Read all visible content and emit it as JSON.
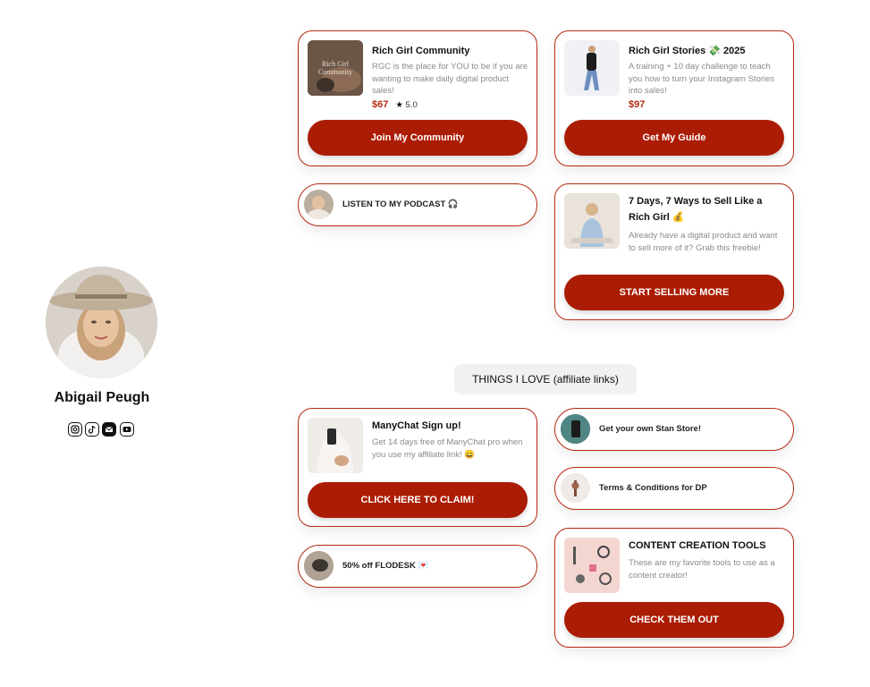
{
  "profile": {
    "name": "Abigail Peugh",
    "social_icons": [
      "instagram-icon",
      "tiktok-icon",
      "email-icon",
      "youtube-icon"
    ]
  },
  "cards": {
    "rgc": {
      "title": "Rich Girl Community",
      "thumb_text": "Rich Girl Community",
      "description": "RGC is the place for YOU to be if you are wanting to make daily digital product sales!",
      "price": "$67",
      "rating": "5.0",
      "button": "Join My Community"
    },
    "stories": {
      "title": "Rich Girl Stories 💸 2025",
      "description": "A training + 10 day challenge to teach you how to turn your Instagram Stories into sales!",
      "price": "$97",
      "button": "Get My Guide"
    },
    "podcast": {
      "label": "LISTEN TO MY PODCAST 🎧"
    },
    "seven_days": {
      "title": "7 Days, 7 Ways to Sell Like a Rich Girl 💰",
      "description": "Already have a digital product and want to sell more of it? Grab this freebie!",
      "button": "START SELLING MORE"
    },
    "manychat": {
      "title": "ManyChat Sign up!",
      "description": "Get 14 days free of ManyChat pro when you use my affiliate link! 😄",
      "button": "CLICK HERE TO CLAIM!"
    },
    "stan": {
      "label": "Get your own Stan Store!"
    },
    "terms": {
      "label": "Terms & Conditions for DP"
    },
    "flodesk": {
      "label": "50% off FLODESK 💌"
    },
    "tools": {
      "title": "CONTENT CREATION TOOLS",
      "description": "These are my favorite tools to use as a content creator!",
      "button": "CHECK THEM OUT"
    }
  },
  "section": {
    "title": "THINGS I LOVE (affiliate links)"
  },
  "colors": {
    "accent": "#ab1c04",
    "border": "#b52a12",
    "price": "#b52a12"
  }
}
